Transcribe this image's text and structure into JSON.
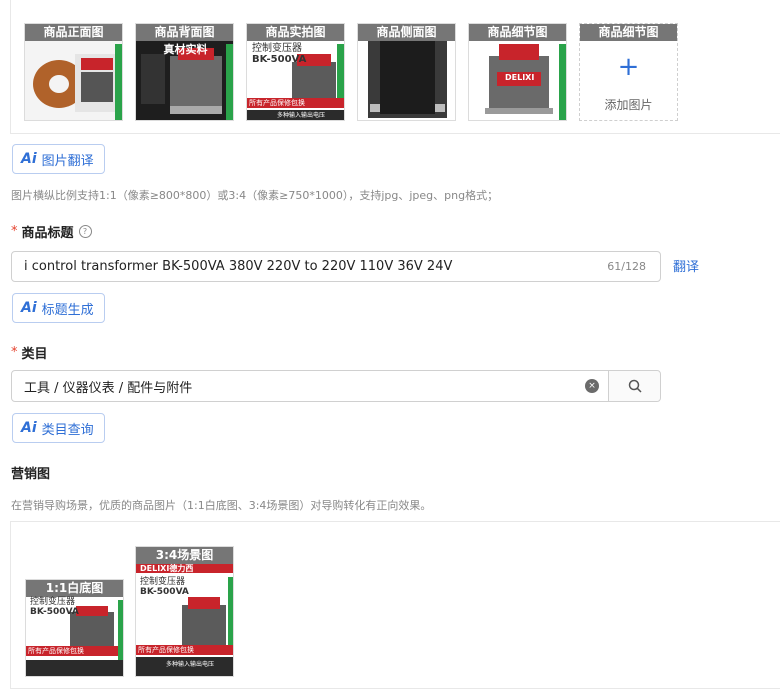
{
  "images": {
    "slots": [
      {
        "caption": "商品正面图"
      },
      {
        "caption": "商品背面图",
        "overlay": "真材实料"
      },
      {
        "caption": "商品实拍图",
        "product_title": "控制变压器",
        "model": "BK-500VA",
        "banner": "所有产品保修包换",
        "footer": "多种输入输出电压"
      },
      {
        "caption": "商品侧面图"
      },
      {
        "caption": "商品细节图",
        "brand": "DELIXI"
      },
      {
        "caption": "商品细节图"
      }
    ],
    "add_label": "添加图片"
  },
  "ai_buttons": {
    "image_translate": {
      "icon": "Ai",
      "label": "图片翻译"
    },
    "title_generate": {
      "icon": "Ai",
      "label": "标题生成"
    },
    "category_query": {
      "icon": "Ai",
      "label": "类目查询"
    }
  },
  "image_hint": "图片横纵比例支持1:1（像素≥800*800）或3:4（像素≥750*1000），支持jpg、jpeg、png格式；",
  "title_field": {
    "required_mark": "*",
    "label": "商品标题",
    "help": "?",
    "value": "i control transformer BK-500VA 380V 220V to 220V 110V 36V 24V",
    "counter": "61/128",
    "translate_link": "翻译"
  },
  "category_field": {
    "required_mark": "*",
    "label": "类目",
    "value": "工具 / 仪器仪表 / 配件与附件",
    "clear": "×"
  },
  "marketing": {
    "label": "营销图",
    "hint": "在营销导购场景，优质的商品图片（1:1白底图、3:4场景图）对导购转化有正向效果。",
    "slots": [
      {
        "caption": "1:1白底图",
        "product_title": "控制变压器",
        "model": "BK-500VA",
        "banner": "所有产品保修包换"
      },
      {
        "caption": "3:4场景图",
        "brand": "DELIXI德力西",
        "product_title": "控制变压器",
        "model": "BK-500VA",
        "banner": "所有产品保修包换",
        "footer": "多种输入输出电压"
      }
    ]
  },
  "colors": {
    "accent": "#2f6fd6",
    "required": "#e5412d",
    "caption_bg": "#767676",
    "product_red": "#c8242b"
  }
}
